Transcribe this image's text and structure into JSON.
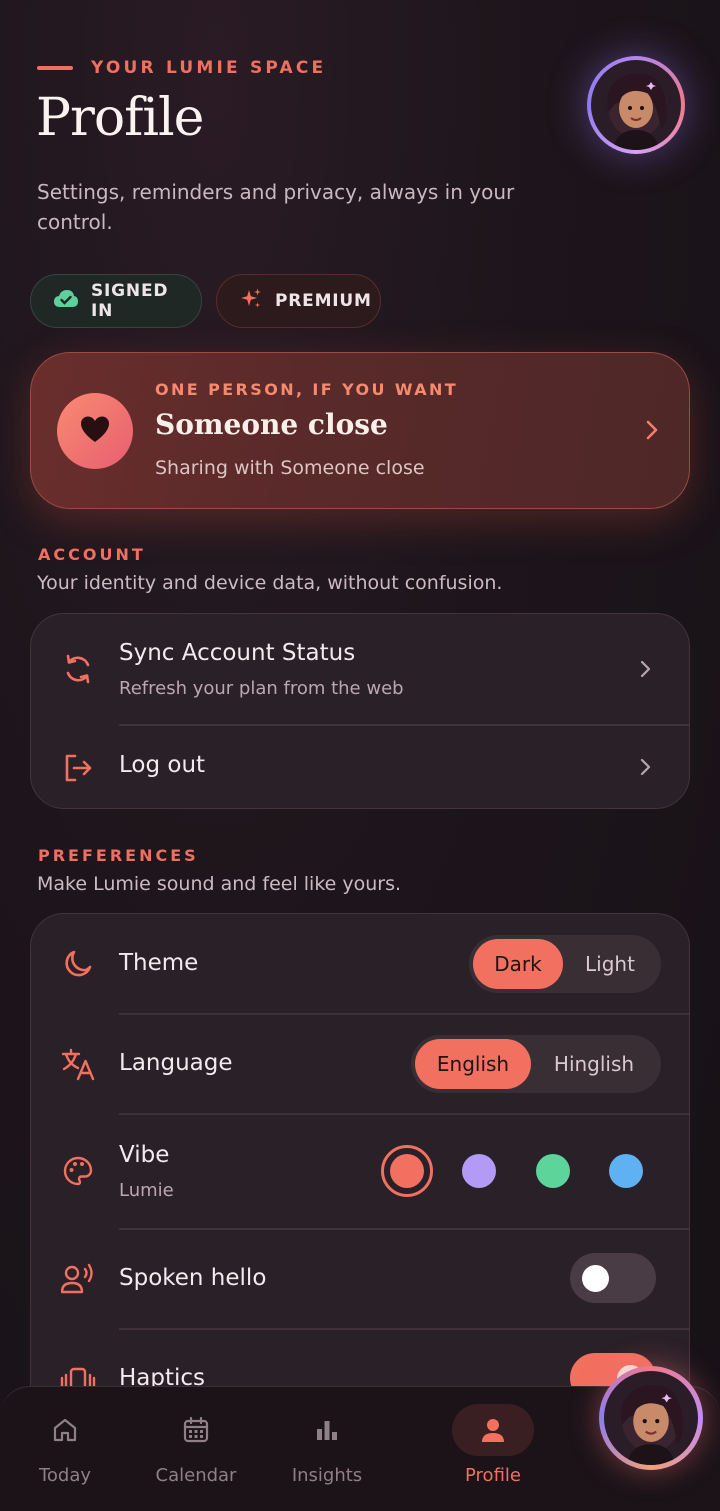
{
  "header": {
    "eyebrow": "YOUR LUMIE SPACE",
    "title": "Profile",
    "subtitle": "Settings, reminders and privacy, always in your control."
  },
  "badges": {
    "signed_in": "SIGNED IN",
    "premium": "PREMIUM"
  },
  "hero": {
    "eyebrow": "ONE PERSON, IF YOU WANT",
    "title": "Someone close",
    "subtitle": "Sharing with Someone close"
  },
  "account": {
    "label": "ACCOUNT",
    "description": "Your identity and device data, without confusion.",
    "items": [
      {
        "label": "Sync Account Status",
        "sub": "Refresh your plan from the web",
        "icon": "sync-icon"
      },
      {
        "label": "Log out",
        "icon": "logout-icon"
      }
    ]
  },
  "preferences": {
    "label": "PREFERENCES",
    "description": "Make Lumie sound and feel like yours.",
    "theme": {
      "label": "Theme",
      "options": [
        "Dark",
        "Light"
      ],
      "selected": "Dark"
    },
    "language": {
      "label": "Language",
      "options": [
        "English",
        "Hinglish"
      ],
      "selected": "English"
    },
    "vibe": {
      "label": "Vibe",
      "value": "Lumie",
      "swatches": [
        "#f2705f",
        "#b39af7",
        "#5dd49a",
        "#5fb1f2"
      ],
      "selected_index": 0
    },
    "spoken_hello": {
      "label": "Spoken hello",
      "on": false
    },
    "haptics": {
      "label": "Haptics",
      "on": true
    }
  },
  "nav": {
    "tabs": [
      {
        "label": "Today",
        "icon": "home-icon"
      },
      {
        "label": "Calendar",
        "icon": "calendar-icon"
      },
      {
        "label": "Insights",
        "icon": "bar-chart-icon"
      },
      {
        "label": "Profile",
        "icon": "person-icon",
        "active": true
      }
    ]
  },
  "colors": {
    "accent": "#f2705f",
    "background": "#1c1419",
    "card": "#2a2027"
  }
}
